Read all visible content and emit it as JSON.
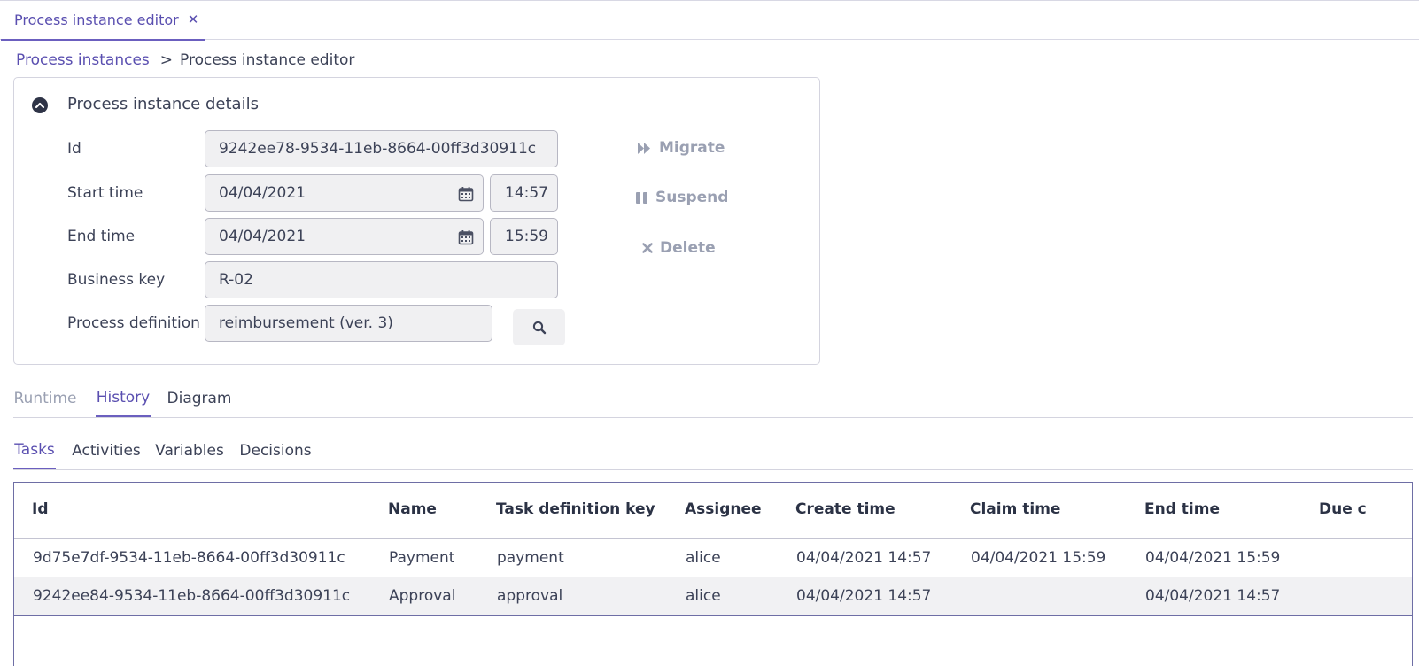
{
  "window_tab": {
    "label": "Process instance editor"
  },
  "breadcrumb": {
    "parent": "Process instances",
    "separator": ">",
    "current": "Process instance editor"
  },
  "details": {
    "title": "Process instance details",
    "id": {
      "label": "Id",
      "value": "9242ee78-9534-11eb-8664-00ff3d30911c"
    },
    "start_time": {
      "label": "Start time",
      "date": "04/04/2021",
      "time": "14:57"
    },
    "end_time": {
      "label": "End time",
      "date": "04/04/2021",
      "time": "15:59"
    },
    "business_key": {
      "label": "Business key",
      "value": "R-02"
    },
    "process_definition": {
      "label": "Process definition",
      "value": "reimbursement (ver. 3)"
    }
  },
  "actions": {
    "migrate": "Migrate",
    "suspend": "Suspend",
    "delete": "Delete"
  },
  "main_tabs": [
    {
      "label": "Runtime",
      "state": "disabled"
    },
    {
      "label": "History",
      "state": "active"
    },
    {
      "label": "Diagram",
      "state": "normal"
    }
  ],
  "history_tabs": [
    {
      "label": "Tasks",
      "state": "active"
    },
    {
      "label": "Activities",
      "state": "normal"
    },
    {
      "label": "Variables",
      "state": "normal"
    },
    {
      "label": "Decisions",
      "state": "normal"
    }
  ],
  "tasks_table": {
    "columns": [
      "Id",
      "Name",
      "Task definition key",
      "Assignee",
      "Create time",
      "Claim time",
      "End time",
      "Due c"
    ],
    "rows": [
      [
        "9d75e7df-9534-11eb-8664-00ff3d30911c",
        "Payment",
        "payment",
        "alice",
        "04/04/2021 14:57",
        "04/04/2021 15:59",
        "04/04/2021 15:59",
        ""
      ],
      [
        "9242ee84-9534-11eb-8664-00ff3d30911c",
        "Approval",
        "approval",
        "alice",
        "04/04/2021 14:57",
        "",
        "04/04/2021 14:57",
        ""
      ]
    ]
  },
  "colors": {
    "accent": "#5a4fb0",
    "text": "#3c4257",
    "muted": "#9aa0b2",
    "field_bg": "#f0f0f2"
  }
}
